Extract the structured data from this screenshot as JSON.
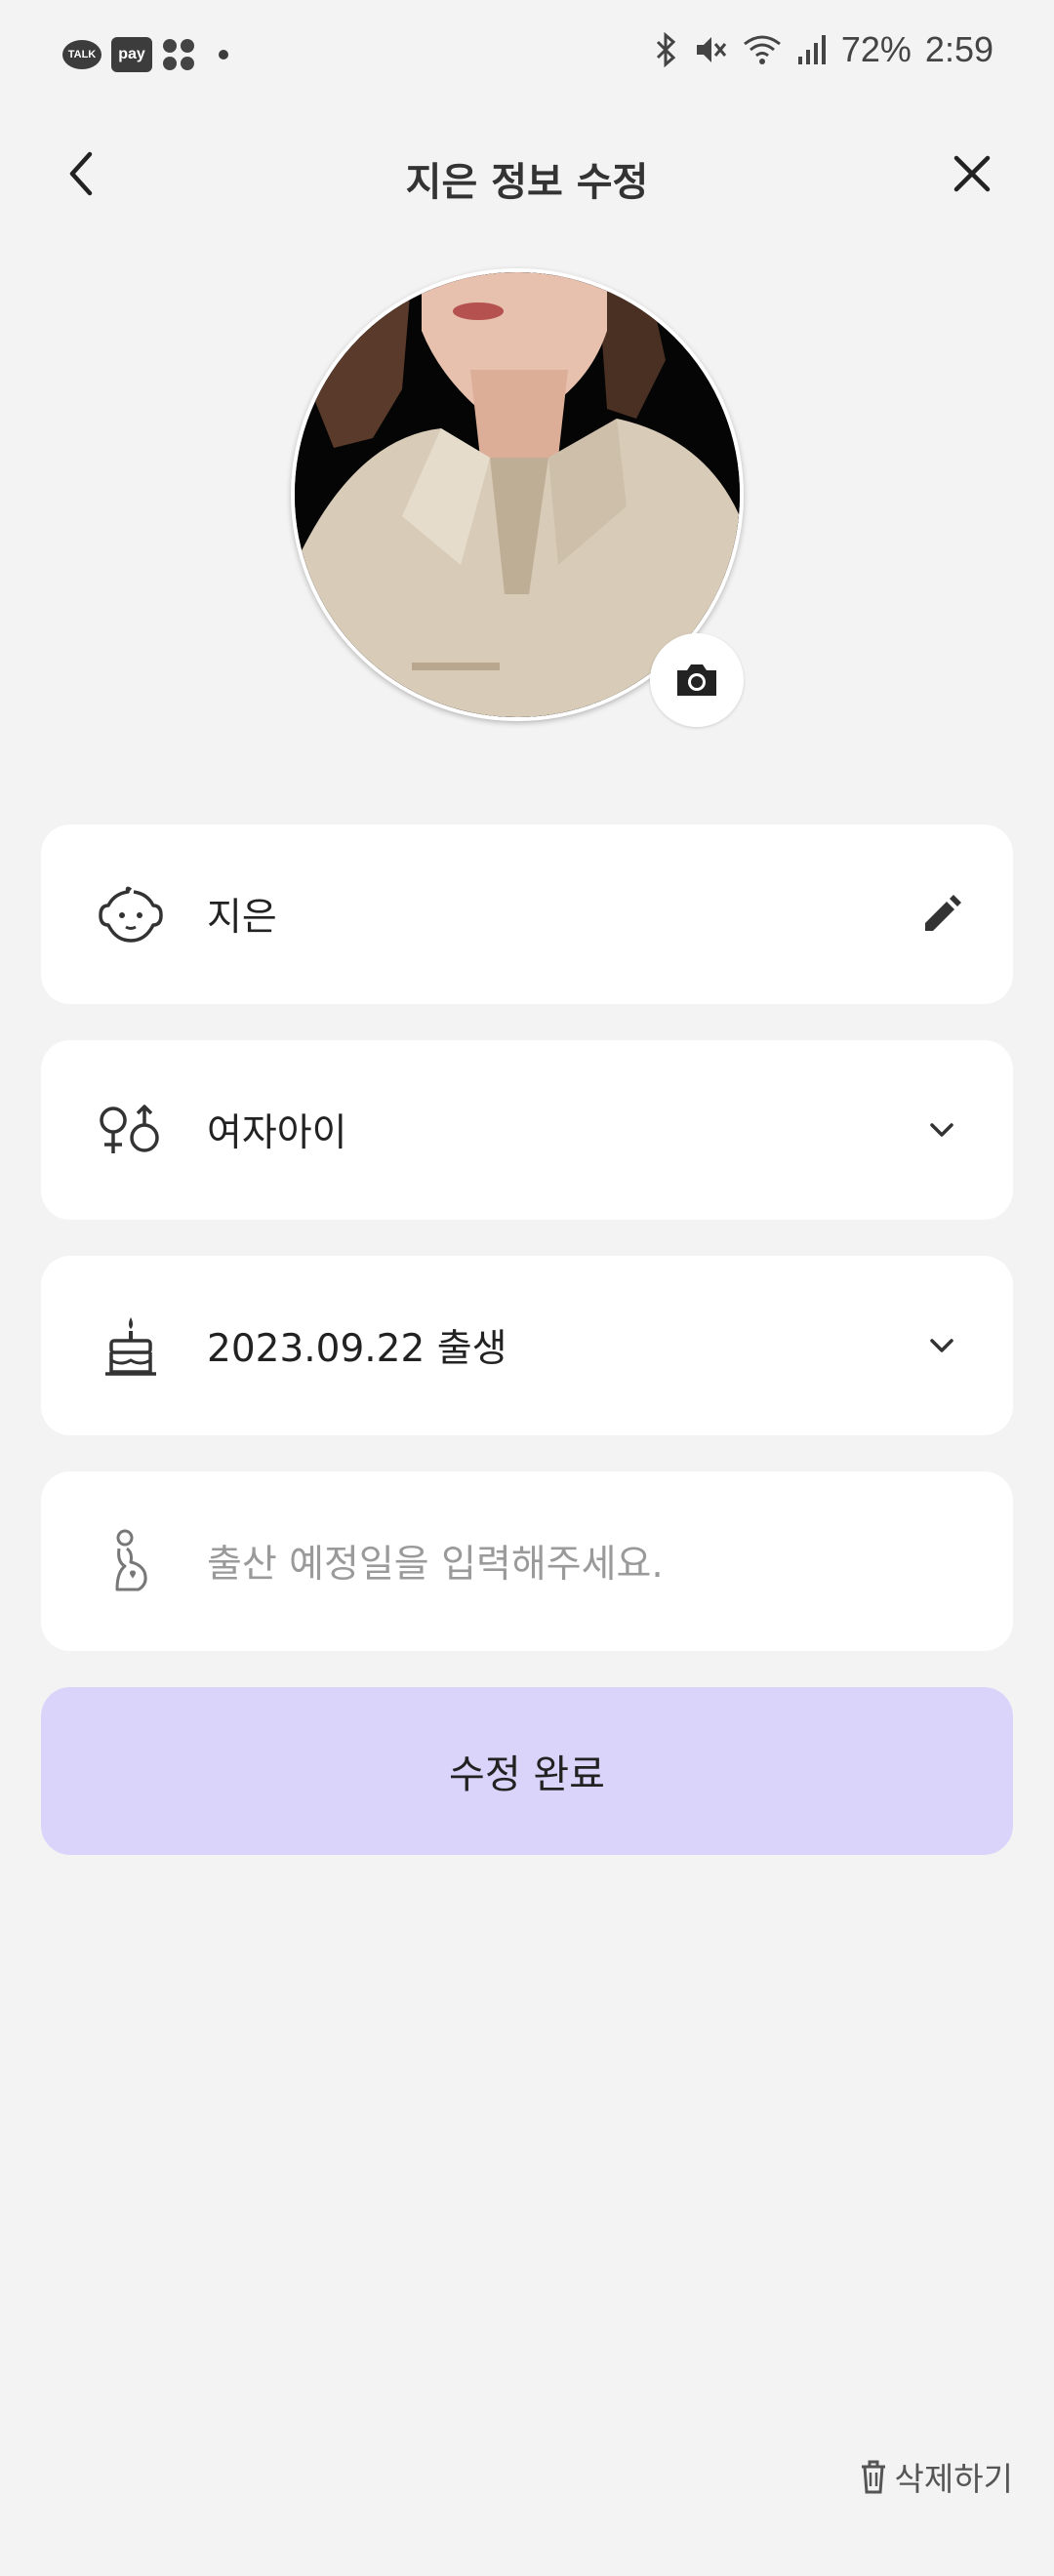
{
  "status_bar": {
    "talk_label": "TALK",
    "pay_label": "pay",
    "battery": "72%",
    "time": "2:59"
  },
  "header": {
    "title": "지은 정보 수정"
  },
  "profile": {
    "name_value": "지은",
    "gender_value": "여자아이",
    "birth_value": "2023.09.22 출생",
    "due_date_placeholder": "출산 예정일을 입력해주세요."
  },
  "actions": {
    "submit_label": "수정 완료",
    "delete_label": "삭제하기"
  },
  "colors": {
    "background": "#f3f3f3",
    "card": "#ffffff",
    "submit_button": "#dbd4fa"
  },
  "icons": [
    "back-arrow-icon",
    "close-icon",
    "camera-icon",
    "baby-face-icon",
    "pencil-icon",
    "gender-icon",
    "chevron-down-icon",
    "cake-icon",
    "pregnant-icon",
    "trash-icon"
  ]
}
